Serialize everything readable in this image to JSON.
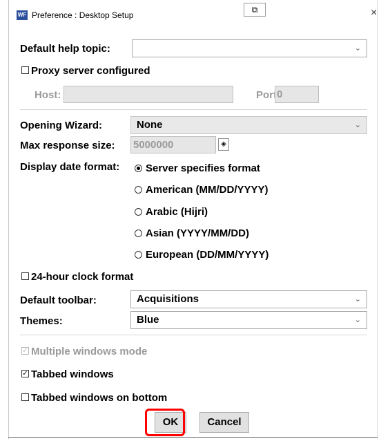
{
  "window": {
    "app_icon_text": "WF",
    "title": "Preference : Desktop Setup",
    "restore_glyph": "⧉",
    "close_glyph": "×"
  },
  "help": {
    "label": "Default help topic:",
    "value": ""
  },
  "proxy": {
    "label": "Proxy server configured",
    "checked": false,
    "host_label": "Host:",
    "host_value": "",
    "port_label": "Port:",
    "port_value": "0"
  },
  "opening_wizard": {
    "label": "Opening Wizard:",
    "value": "None"
  },
  "max_response": {
    "label": "Max response size:",
    "value": "5000000",
    "spin_glyph": "◈"
  },
  "date_format": {
    "label": "Display date format:",
    "options": [
      {
        "label": "Server specifies format",
        "selected": true
      },
      {
        "label": "American (MM/DD/YYYY)",
        "selected": false
      },
      {
        "label": "Arabic (Hijri)",
        "selected": false
      },
      {
        "label": "Asian (YYYY/MM/DD)",
        "selected": false
      },
      {
        "label": "European (DD/MM/YYYY)",
        "selected": false
      }
    ]
  },
  "clock": {
    "label": "24-hour clock format",
    "checked": false
  },
  "toolbar": {
    "label": "Default toolbar:",
    "value": "Acquisitions"
  },
  "themes": {
    "label": "Themes:",
    "value": "Blue"
  },
  "windows": {
    "multiple_label": "Multiple windows mode",
    "multiple_checked": true,
    "multiple_disabled": true,
    "tabbed_label": "Tabbed windows",
    "tabbed_checked": true,
    "tabbed_bottom_label": "Tabbed windows on bottom",
    "tabbed_bottom_checked": false
  },
  "buttons": {
    "ok": "OK",
    "cancel": "Cancel"
  },
  "colors": {
    "highlight": "#ff0000",
    "app_icon": "#2a4f9c"
  }
}
